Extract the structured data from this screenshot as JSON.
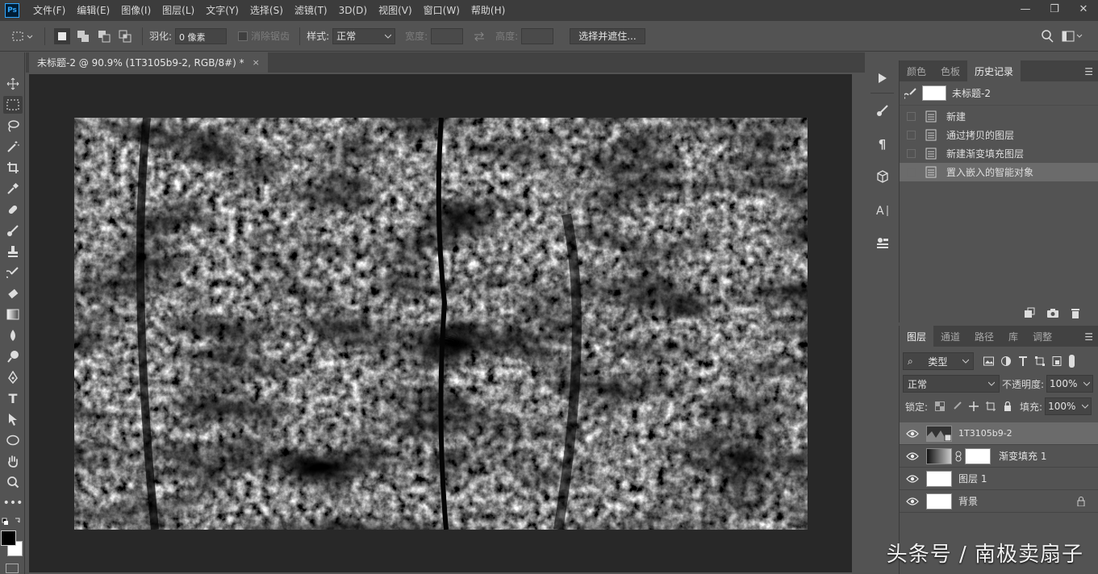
{
  "app": {
    "logo": "Ps"
  },
  "menu": [
    "文件(F)",
    "编辑(E)",
    "图像(I)",
    "图层(L)",
    "文字(Y)",
    "选择(S)",
    "滤镜(T)",
    "3D(D)",
    "视图(V)",
    "窗口(W)",
    "帮助(H)"
  ],
  "window_controls": {
    "minimize": "—",
    "restore": "❐",
    "close": "✕"
  },
  "options": {
    "feather_label": "羽化:",
    "feather_value": "0 像素",
    "antialias_label": "消除锯齿",
    "style_label": "样式:",
    "style_value": "正常",
    "width_label": "宽度:",
    "height_label": "高度:",
    "select_mask_button": "选择并遮住..."
  },
  "document": {
    "tab_title": "未标题-2 @ 90.9% (1T3105b9-2, RGB/8#) *",
    "tab_close": "×"
  },
  "panels": {
    "history": {
      "tabs": [
        "颜色",
        "色板",
        "历史记录"
      ],
      "active_tab": "历史记录",
      "snapshot": "未标题-2",
      "items": [
        {
          "label": "新建"
        },
        {
          "label": "通过拷贝的图层"
        },
        {
          "label": "新建渐变填充图层"
        },
        {
          "label": "置入嵌入的智能对象"
        }
      ]
    },
    "layers": {
      "tabs": [
        "图层",
        "通道",
        "路径",
        "库",
        "调整"
      ],
      "active_tab": "图层",
      "filter_value": "类型",
      "blend_mode": "正常",
      "opacity_label": "不透明度:",
      "opacity_value": "100%",
      "lock_label": "锁定:",
      "fill_label": "填充:",
      "fill_value": "100%",
      "items": [
        {
          "name": "1T3105b9-2"
        },
        {
          "name": "渐变填充 1"
        },
        {
          "name": "图层 1"
        },
        {
          "name": "背景"
        }
      ]
    }
  },
  "watermark": "头条号 / 南极卖扇子"
}
